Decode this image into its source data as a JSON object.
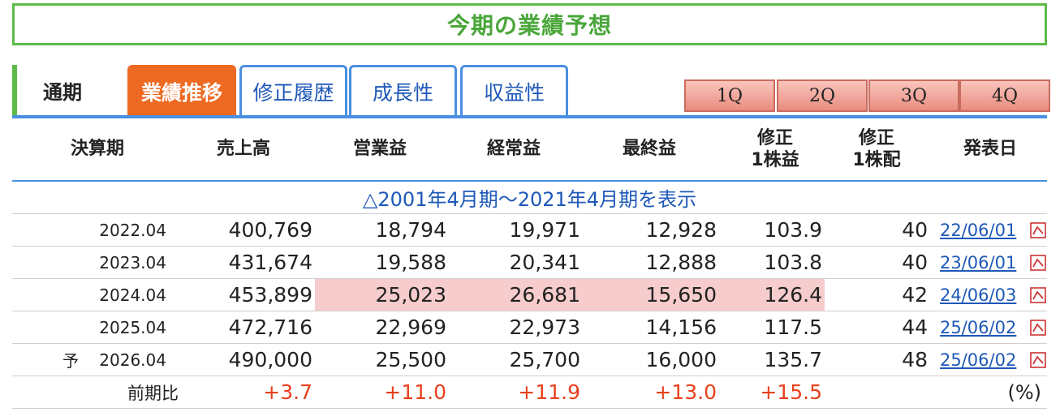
{
  "title": "今期の業績予想",
  "tabs": {
    "label": "通期",
    "items": [
      "業績推移",
      "修正履歴",
      "成長性",
      "収益性"
    ],
    "quarters": [
      "1Q",
      "2Q",
      "3Q",
      "4Q"
    ]
  },
  "table": {
    "headers": [
      "決算期",
      "売上高",
      "営業益",
      "経常益",
      "最終益",
      "修正\n1株益",
      "修正\n1株配",
      "発表日"
    ],
    "show_history": "△2001年4月期〜2021年4月期を表示",
    "rows": [
      {
        "mark": "",
        "period": "2022.04",
        "sales": "400,769",
        "op": "18,794",
        "ord": "19,971",
        "net": "12,928",
        "eps": "103.9",
        "div": "40",
        "date": "22/06/01"
      },
      {
        "mark": "",
        "period": "2023.04",
        "sales": "431,674",
        "op": "19,588",
        "ord": "20,341",
        "net": "12,888",
        "eps": "103.8",
        "div": "40",
        "date": "23/06/01"
      },
      {
        "mark": "",
        "period": "2024.04",
        "sales": "453,899",
        "op": "25,023",
        "ord": "26,681",
        "net": "15,650",
        "eps": "126.4",
        "div": "42",
        "date": "24/06/03"
      },
      {
        "mark": "",
        "period": "2025.04",
        "sales": "472,716",
        "op": "22,969",
        "ord": "22,973",
        "net": "14,156",
        "eps": "117.5",
        "div": "44",
        "date": "25/06/02"
      },
      {
        "mark": "予",
        "period": "2026.04",
        "sales": "490,000",
        "op": "25,500",
        "ord": "25,700",
        "net": "16,000",
        "eps": "135.7",
        "div": "48",
        "date": "25/06/02"
      }
    ],
    "ratio": {
      "label": "前期比",
      "sales": "+3.7",
      "op": "+11.0",
      "ord": "+11.9",
      "net": "+13.0",
      "eps": "+15.5",
      "unit": "(%)"
    }
  },
  "colors": {
    "accent_green": "#5dbb4a",
    "tab_active": "#ee6a22",
    "tab_border": "#4a8fe0",
    "link": "#1e58b8",
    "highlight": "#f6cccc",
    "positive": "#e8401c"
  },
  "icons": {
    "date_link": "pdf-icon"
  }
}
